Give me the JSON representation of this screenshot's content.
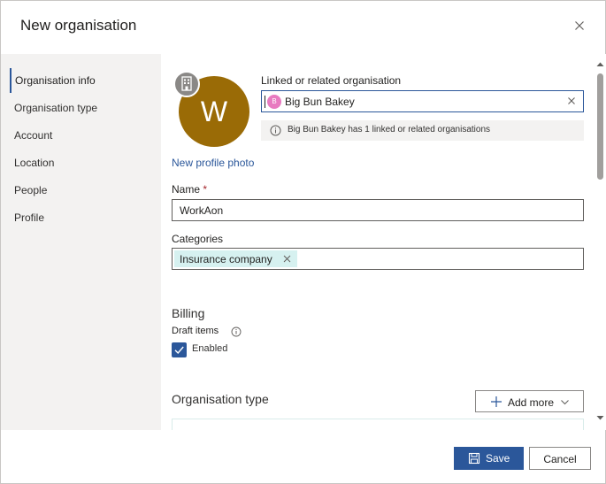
{
  "dialog": {
    "title": "New organisation",
    "close_icon": "close-icon"
  },
  "nav": {
    "items": [
      {
        "label": "Organisation info",
        "active": true
      },
      {
        "label": "Organisation type",
        "active": false
      },
      {
        "label": "Account",
        "active": false
      },
      {
        "label": "Location",
        "active": false
      },
      {
        "label": "People",
        "active": false
      },
      {
        "label": "Profile",
        "active": false
      }
    ]
  },
  "profile": {
    "avatar_initial": "W",
    "avatar_color": "#9a6b06",
    "badge_icon": "building-icon",
    "new_photo_label": "New profile photo"
  },
  "linked": {
    "label": "Linked or related organisation",
    "persona_initial": "B",
    "persona_color": "#e87ac0",
    "value": "Big Bun Bakey",
    "info_text": "Big Bun Bakey has 1 linked or related organisations"
  },
  "name_field": {
    "label": "Name",
    "required_mark": "*",
    "value": "WorkAon"
  },
  "categories": {
    "label": "Categories",
    "tags": [
      "Insurance company"
    ]
  },
  "billing": {
    "title": "Billing",
    "draft_items_label": "Draft items",
    "enabled_label": "Enabled",
    "enabled": true
  },
  "org_type": {
    "title": "Organisation type",
    "add_more_label": "Add more"
  },
  "footer": {
    "save_label": "Save",
    "cancel_label": "Cancel"
  },
  "colors": {
    "accent": "#2b579a",
    "tag_bg": "#d6f1f0"
  }
}
